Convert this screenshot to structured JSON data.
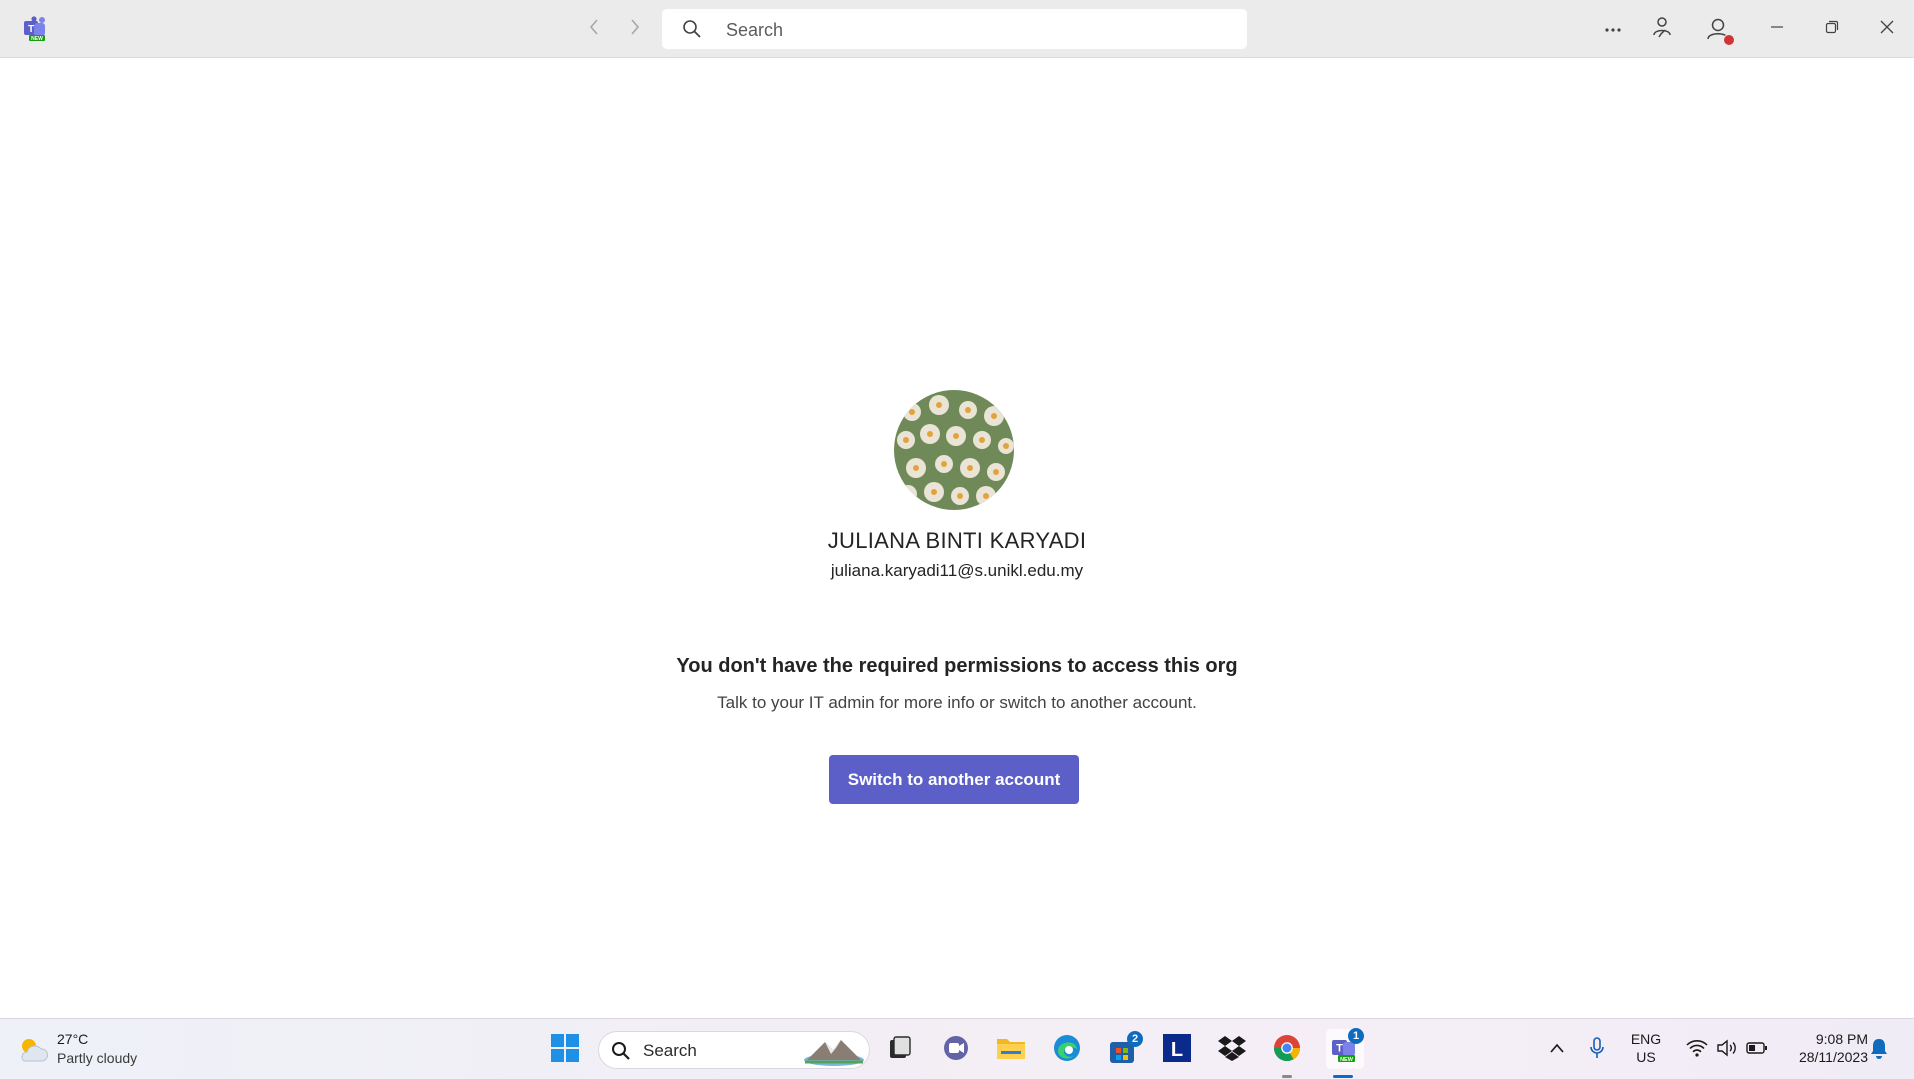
{
  "titlebar": {
    "search_placeholder": "Search"
  },
  "account": {
    "name": "JULIANA BINTI KARYADI",
    "email": "juliana.karyadi11@s.unikl.edu.my"
  },
  "error": {
    "title": "You don't have the required permissions to access this org",
    "description": "Talk to your IT admin for more info or switch to another account.",
    "button_label": "Switch to another account"
  },
  "taskbar": {
    "weather_temp": "27°C",
    "weather_desc": "Partly cloudy",
    "search_label": "Search",
    "store_badge": "2",
    "teams_badge": "1",
    "language_primary": "ENG",
    "language_secondary": "US",
    "time": "9:08 PM",
    "date": "28/11/2023"
  },
  "colors": {
    "accent": "#5b5fc7",
    "presence_busy": "#d13438",
    "titlebar_bg": "#ebebeb"
  },
  "icons": [
    "teams-new-logo-icon",
    "back-arrow-icon",
    "forward-arrow-icon",
    "search-icon",
    "more-options-icon",
    "collaborators-icon",
    "profile-icon",
    "minimize-icon",
    "maximize-icon",
    "close-icon",
    "weather-icon",
    "windows-start-icon",
    "task-view-icon",
    "teams-chat-icon",
    "file-explorer-icon",
    "edge-icon",
    "store-icon",
    "l-app-icon",
    "dropbox-icon",
    "chrome-icon",
    "teams-taskbar-icon",
    "chevron-up-icon",
    "microphone-icon",
    "wifi-icon",
    "volume-icon",
    "battery-icon",
    "notification-bell-icon"
  ]
}
